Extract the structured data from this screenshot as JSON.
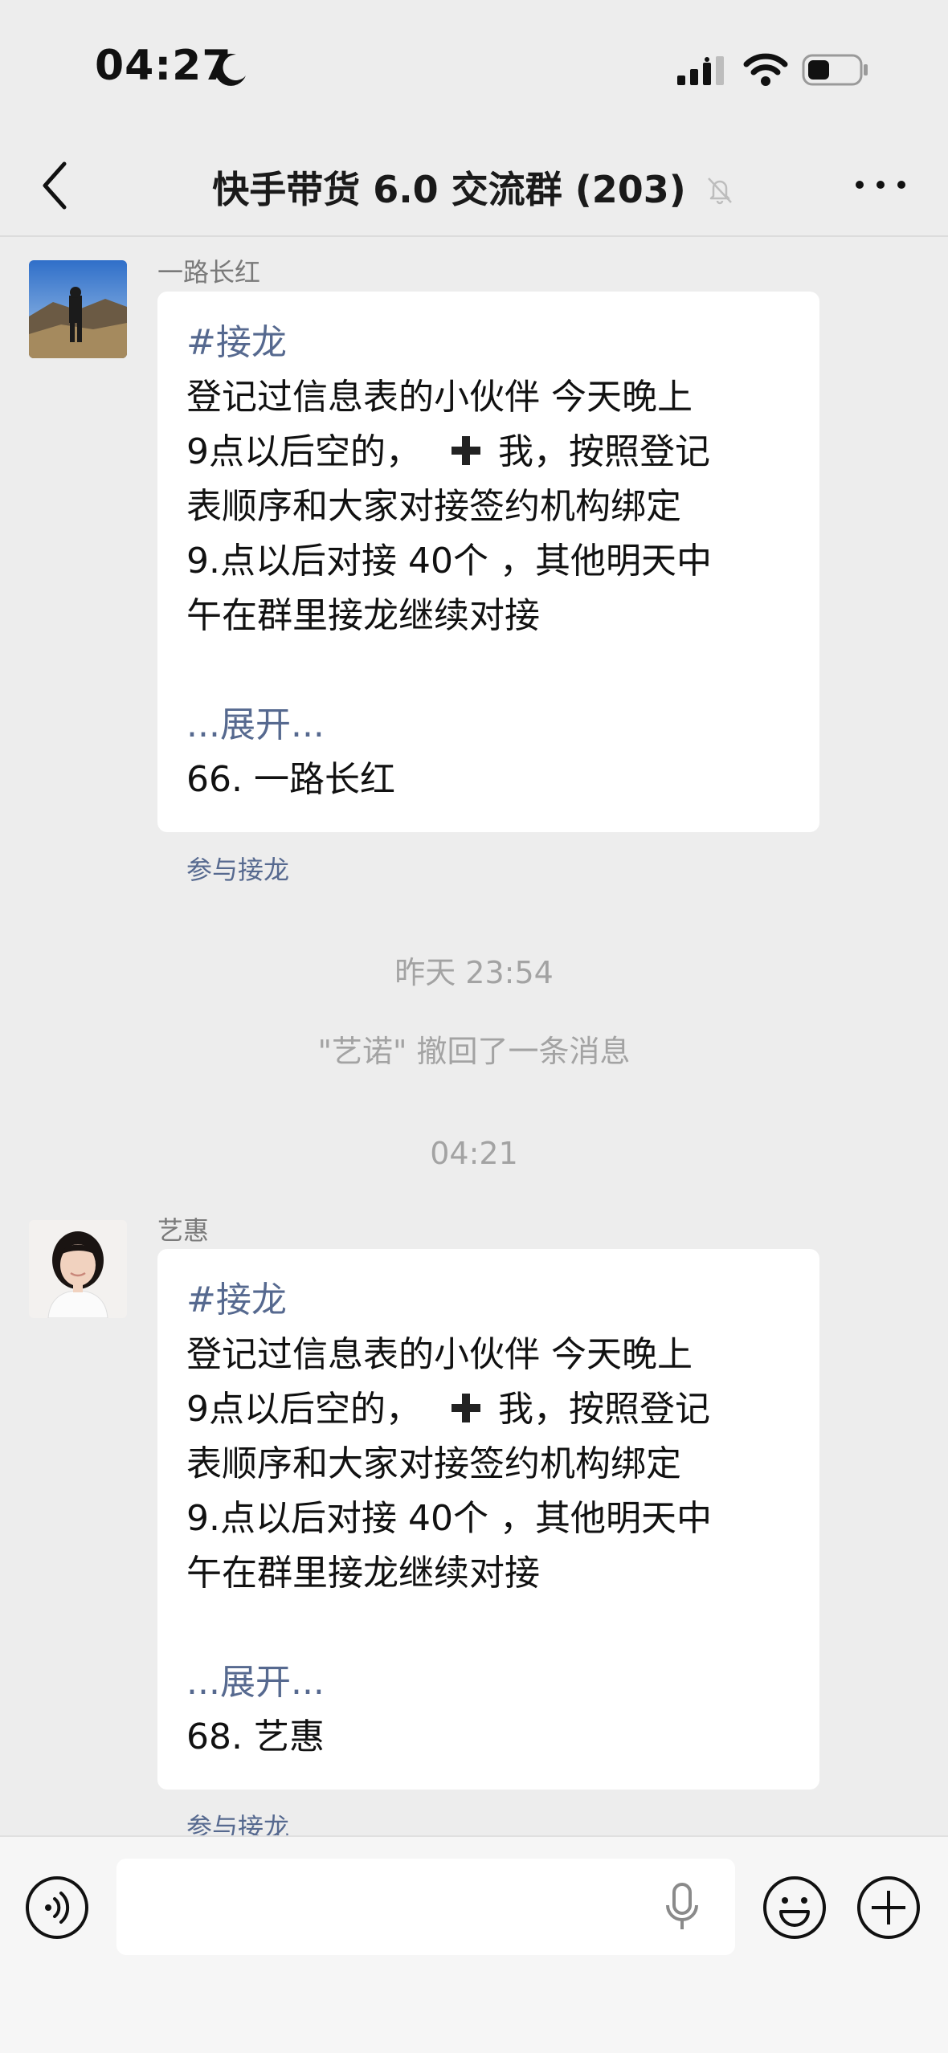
{
  "status": {
    "time": "04:27"
  },
  "nav": {
    "title": "快手带货 6.0 交流群 (203)"
  },
  "messages": [
    {
      "sender": "一路长红",
      "tag": "#接龙",
      "lines": [
        "登记过信息表的小伙伴  今天晚上",
        "9点以后空的，",
        "表顺序和大家对接签约机构绑定",
        "9.点以后对接 40个  ，其他明天中",
        "午在群里接龙继续对接"
      ],
      "plus_text": "我，按照登记",
      "expand": "...展开...",
      "entry": "66. 一路长红",
      "join": "参与接龙"
    },
    {
      "sender": "艺惠",
      "tag": "#接龙",
      "lines": [
        "登记过信息表的小伙伴  今天晚上",
        "9点以后空的，",
        "表顺序和大家对接签约机构绑定",
        "9.点以后对接 40个  ，其他明天中",
        "午在群里接龙继续对接"
      ],
      "plus_text": "我，按照登记",
      "expand": "...展开...",
      "entry": "68. 艺惠",
      "join": "参与接龙"
    }
  ],
  "timestamps": {
    "yesterday": "昨天 23:54",
    "today": "04:21"
  },
  "recall_notice": "\"艺诺\" 撤回了一条消息",
  "input": {
    "placeholder": ""
  },
  "icons": {
    "status": [
      "moon-icon",
      "signal-icon",
      "wifi-icon",
      "battery-icon"
    ],
    "nav": [
      "back-icon",
      "mute-icon",
      "more-icon"
    ],
    "input": [
      "voice-icon",
      "mic-icon",
      "emoji-icon",
      "plus-icon"
    ]
  },
  "colors": {
    "link": "#56698f",
    "background": "#ededed",
    "bubble": "#ffffff"
  }
}
